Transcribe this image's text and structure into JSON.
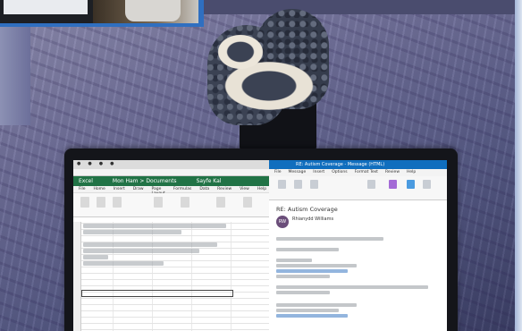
{
  "photo": {
    "subject": "",
    "laptop": {
      "excel": {
        "app_title": "Excel",
        "file_title": "Mon Ham > Documents",
        "user": "Sayfe Kal",
        "menu": [
          "File",
          "Home",
          "Insert",
          "Draw",
          "Page Layout",
          "Formulas",
          "Data",
          "Review",
          "View",
          "Help"
        ],
        "tabs": [
          "●",
          "●",
          "●",
          "●"
        ]
      },
      "outlook": {
        "window_title": "RE: Autism Coverage - Message (HTML)",
        "menu": [
          "File",
          "Message",
          "Insert",
          "Options",
          "Format Text",
          "Review",
          "Help"
        ],
        "subject": "RE: Autism Coverage",
        "sender_initials": "RW",
        "sender_name": "Rhianydd Williams"
      }
    }
  }
}
